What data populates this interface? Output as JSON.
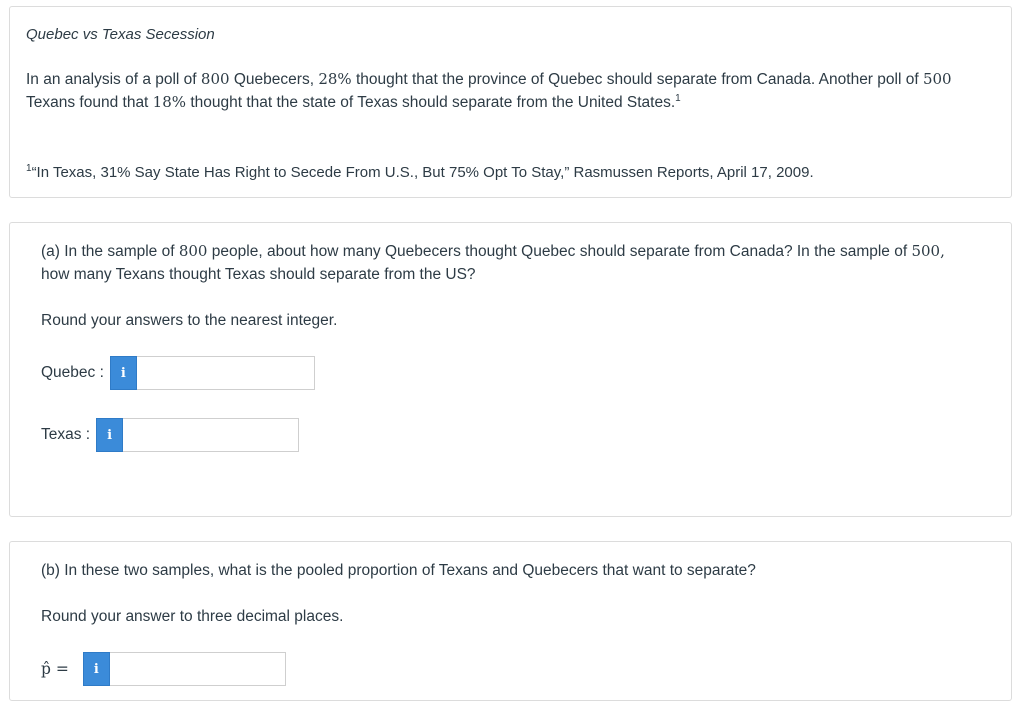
{
  "intro": {
    "title": "Quebec vs Texas Secession",
    "p1": "In an analysis of a poll of ",
    "n1": "800",
    "p2": " Quebecers, ",
    "pct1": "28%",
    "p3": " thought that the province of Quebec should separate from Canada. Another poll of ",
    "n2": "500",
    "p4": "Texans found that ",
    "pct2": "18%",
    "p5": " thought that the state of Texas should separate from the United States.",
    "footnote_mark": "1",
    "footnote_text": "“In Texas, 31% Say State Has Right to Secede From U.S., But 75% Opt To Stay,” Rasmussen Reports, April 17, 2009."
  },
  "part_a": {
    "q1": "(a) In the sample of ",
    "n1": "800",
    "q2": " people, about how many Quebecers thought Quebec should separate from Canada? In the sample of ",
    "n2": "500,",
    "q3": "how many Texans thought Texas should separate from the US?",
    "round_note": "Round your answers to the nearest integer.",
    "quebec_label": "Quebec :",
    "texas_label": "Texas :",
    "info_glyph": "i",
    "quebec_value": "",
    "texas_value": ""
  },
  "part_b": {
    "question": "(b) In these two samples, what is the pooled proportion of Texans and Quebecers that want to separate?",
    "round_note": "Round your answer to three decimal places.",
    "p_hat_label": "p̂ =",
    "info_glyph": "i",
    "p_hat_value": ""
  },
  "colors": {
    "info_button": "#3b8bd9",
    "card_border": "#dcdcdc",
    "text": "#2d3b45"
  }
}
